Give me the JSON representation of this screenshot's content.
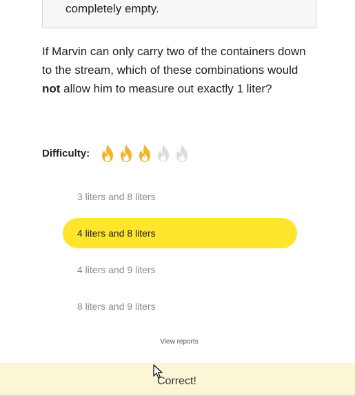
{
  "previous_panel": {
    "text": "completely empty."
  },
  "question": {
    "part1": "If Marvin can only carry two of the containers down to the stream, which of these combinations would ",
    "emphasis": "not",
    "part2": " allow him to measure out exactly 1 liter?"
  },
  "difficulty": {
    "label": "Difficulty:",
    "level": 3,
    "max": 5,
    "icon": "flame-icon",
    "lit_color": "#f2b42a",
    "unlit_color": "#dcdcdc"
  },
  "choices": [
    {
      "label": "3 liters and 8 liters",
      "selected": false
    },
    {
      "label": "4 liters and 8 liters",
      "selected": true
    },
    {
      "label": "4 liters and 9 liters",
      "selected": false
    },
    {
      "label": "8 liters and 9 liters",
      "selected": false
    }
  ],
  "selected_color": "#ffe52c",
  "view_reports": "View reports",
  "feedback": {
    "text": "Correct!",
    "background": "#fbf6d6"
  }
}
